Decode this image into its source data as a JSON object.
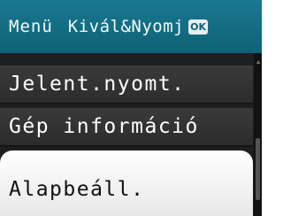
{
  "header": {
    "title": "Menü",
    "hint": "Kivál&Nyomj",
    "ok_icon_label": "OK"
  },
  "menu": {
    "items": [
      {
        "label": "Jelent.nyomt."
      },
      {
        "label": "Gép információ"
      },
      {
        "label": "Alapbeáll.",
        "selected": true
      }
    ]
  },
  "colors": {
    "header_bg": "#0e6276",
    "item_bg": "#333333",
    "selected_bg": "#f4f4f4",
    "screen_bg": "#1e1f21"
  },
  "icons": [
    "ok-key-icon",
    "scroll-up-icon"
  ]
}
